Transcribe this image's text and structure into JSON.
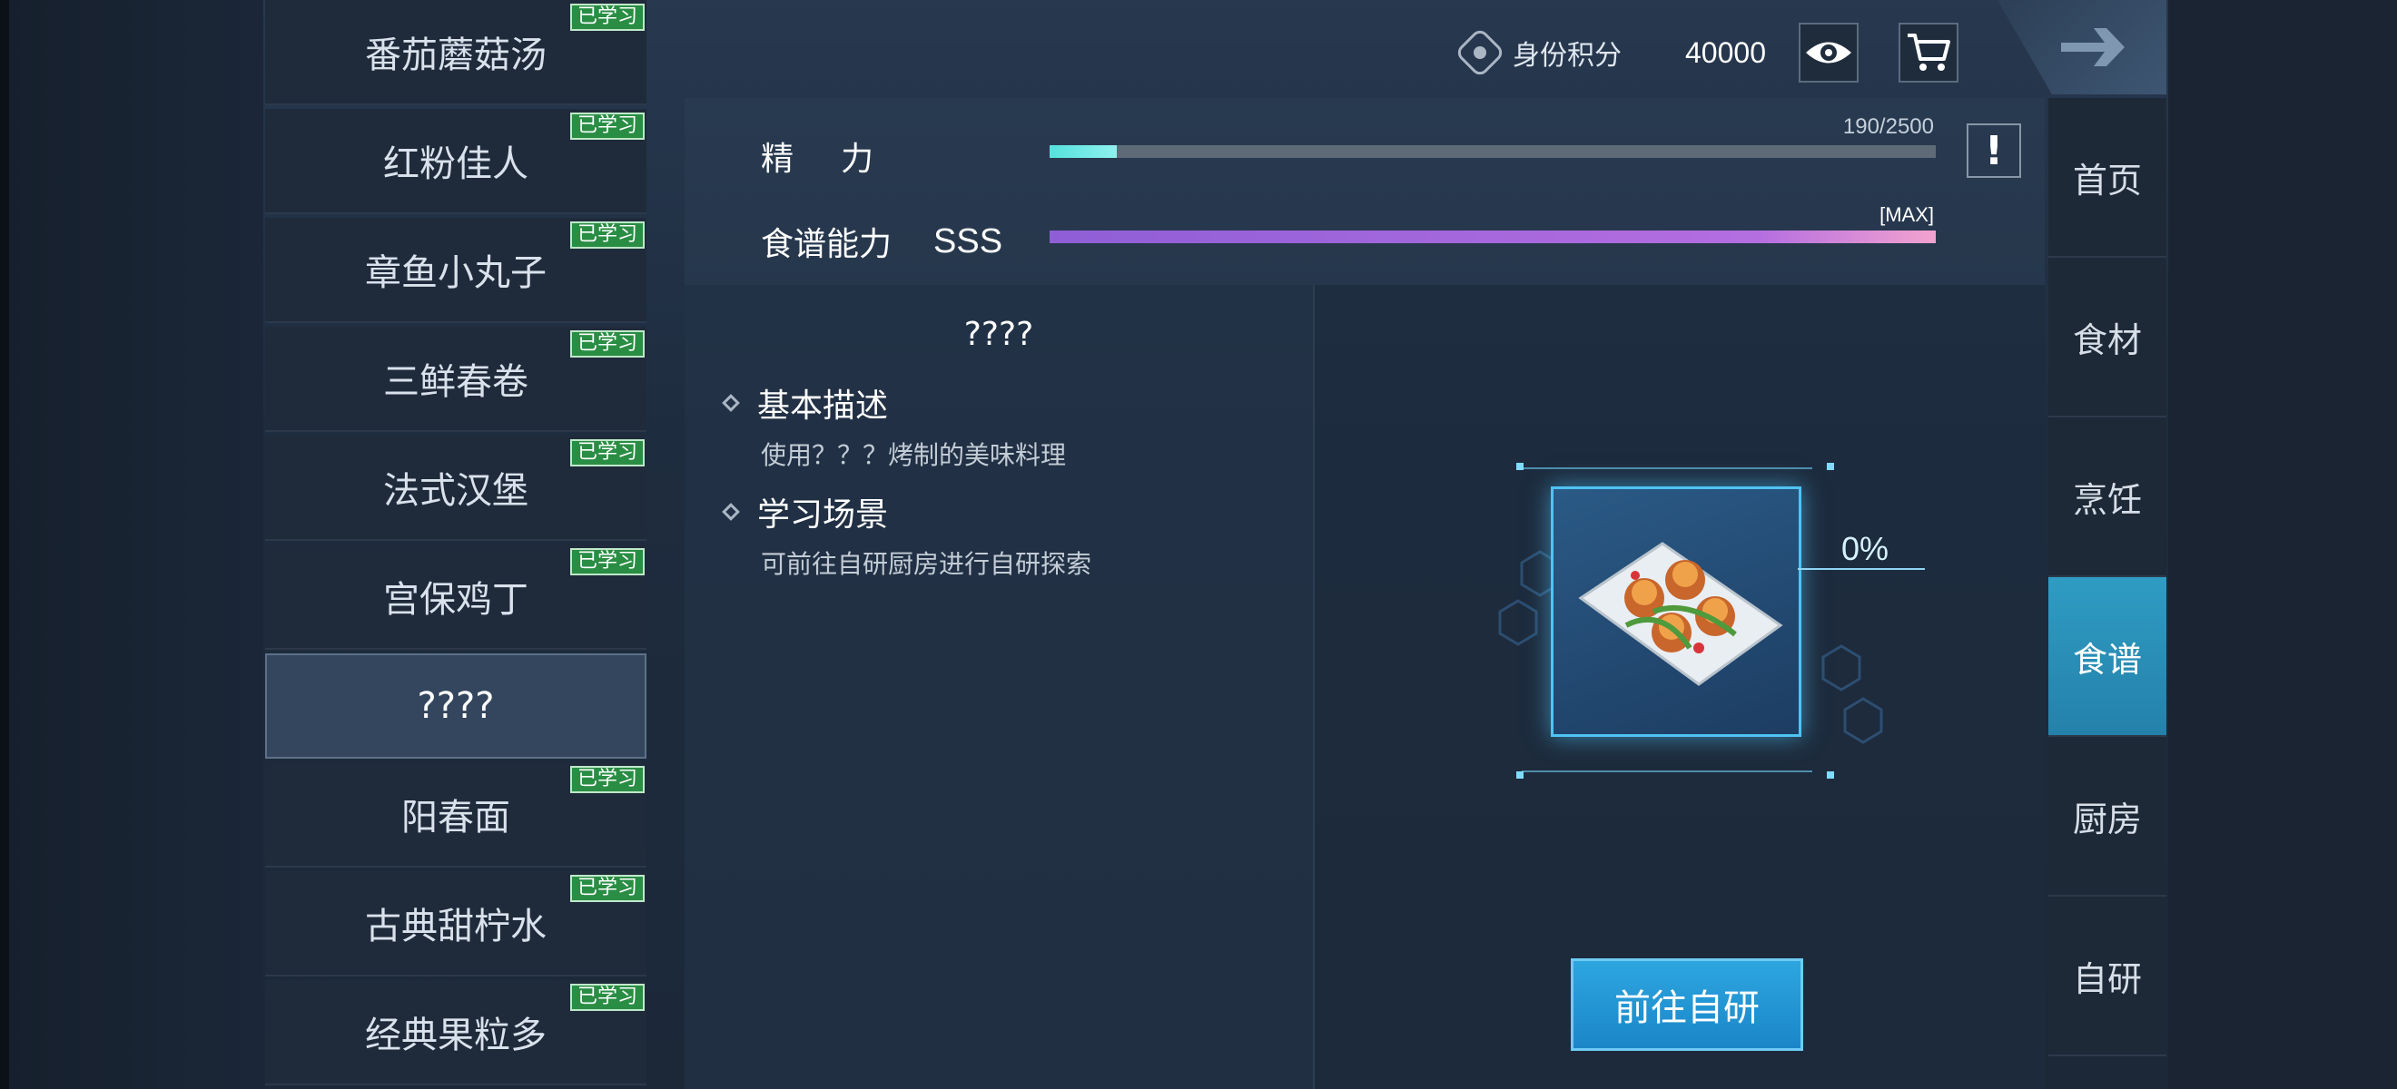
{
  "breadcrumb": "食谱",
  "header": {
    "identity_label": "身份积分",
    "identity_value": "40000",
    "icons": [
      "identity-icon",
      "eye-icon",
      "cart-icon",
      "back-arrow-icon"
    ]
  },
  "recipes": [
    {
      "name": "番茄蘑菇汤",
      "badge": "已学习"
    },
    {
      "name": "红粉佳人",
      "badge": "已学习"
    },
    {
      "name": "章鱼小丸子",
      "badge": "已学习"
    },
    {
      "name": "三鲜春卷",
      "badge": "已学习"
    },
    {
      "name": "法式汉堡",
      "badge": "已学习"
    },
    {
      "name": "宫保鸡丁",
      "badge": "已学习"
    },
    {
      "name": "????",
      "badge": ""
    },
    {
      "name": "阳春面",
      "badge": "已学习"
    },
    {
      "name": "古典甜柠水",
      "badge": "已学习"
    },
    {
      "name": "经典果粒多",
      "badge": "已学习"
    }
  ],
  "stats": {
    "energy_label": "精力",
    "energy_text": "190/2500",
    "energy_fraction": 0.076,
    "ability_label": "食谱能力",
    "ability_rank": "SSS",
    "ability_text": "[MAX]",
    "ability_fraction": 1.0,
    "warn_label": "!"
  },
  "detail": {
    "title": "????",
    "sections": [
      {
        "heading": "基本描述",
        "text": "使用？？？烤制的美味料理"
      },
      {
        "heading": "学习场景",
        "text": "可前往自研厨房进行自研探索"
      }
    ],
    "progress_label": "0%",
    "button_label": "前往自研"
  },
  "nav": [
    {
      "label": "首页",
      "active": false
    },
    {
      "label": "食材",
      "active": false
    },
    {
      "label": "烹饪",
      "active": false
    },
    {
      "label": "食谱",
      "active": true
    },
    {
      "label": "厨房",
      "active": false
    },
    {
      "label": "自研",
      "active": false
    }
  ],
  "colors": {
    "accent": "#2da6e0",
    "badge": "#2a8d44",
    "energy": "#55e1dd",
    "ability": "#8f5ed6"
  }
}
